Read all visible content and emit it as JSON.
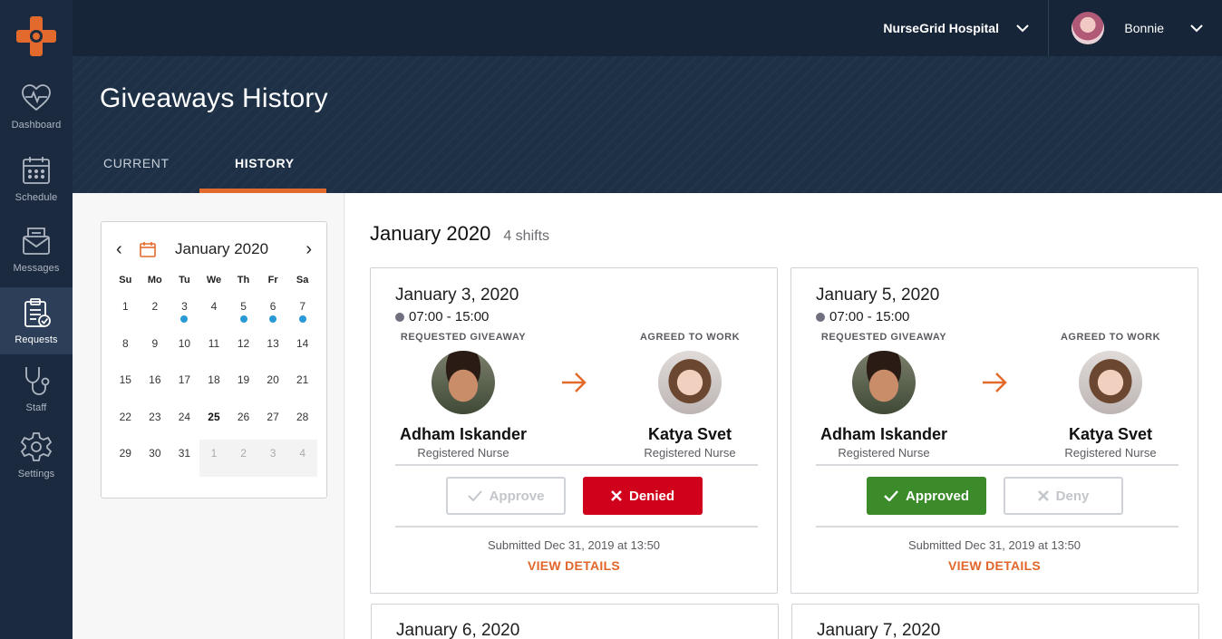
{
  "org": {
    "name": "NurseGrid Hospital"
  },
  "user": {
    "name": "Bonnie"
  },
  "sidebar": {
    "items": [
      {
        "label": "Dashboard",
        "icon": "heart-pulse-icon"
      },
      {
        "label": "Schedule",
        "icon": "calendar-icon"
      },
      {
        "label": "Messages",
        "icon": "envelope-icon"
      },
      {
        "label": "Requests",
        "icon": "clipboard-check-icon",
        "active": true
      },
      {
        "label": "Staff",
        "icon": "stethoscope-icon"
      },
      {
        "label": "Settings",
        "icon": "gear-icon"
      }
    ]
  },
  "header": {
    "title": "Giveaways History",
    "tabs": [
      {
        "label": "CURRENT"
      },
      {
        "label": "HISTORY",
        "active": true
      }
    ]
  },
  "calendar": {
    "title": "January 2020",
    "weekdays": [
      "Su",
      "Mo",
      "Tu",
      "We",
      "Th",
      "Fr",
      "Sa"
    ],
    "weeks": [
      [
        "1",
        "2",
        "3",
        "4",
        "5",
        "6",
        "7"
      ],
      [
        "8",
        "9",
        "10",
        "11",
        "12",
        "13",
        "14"
      ],
      [
        "15",
        "16",
        "17",
        "18",
        "19",
        "20",
        "21"
      ],
      [
        "22",
        "23",
        "24",
        "25",
        "26",
        "27",
        "28"
      ],
      [
        "29",
        "30",
        "31",
        "1",
        "2",
        "3",
        "4"
      ]
    ],
    "today": "25",
    "marked_days": [
      "3",
      "5",
      "6",
      "7"
    ],
    "marker_color": "#2a9ad6"
  },
  "main": {
    "month": "January 2020",
    "shift_count": "4 shifts"
  },
  "cards": [
    {
      "date": "January 3, 2020",
      "time": "07:00 - 15:00",
      "requested_label": "REQUESTED GIVEAWAY",
      "agreed_label": "AGREED TO WORK",
      "from_name": "Adham Iskander",
      "from_role": "Registered Nurse",
      "to_name": "Katya Svet",
      "to_role": "Registered Nurse",
      "btn_left": "Approve",
      "btn_right": "Denied",
      "status": "denied",
      "submitted": "Submitted Dec 31, 2019 at 13:50",
      "details": "VIEW DETAILS"
    },
    {
      "date": "January 5, 2020",
      "time": "07:00 - 15:00",
      "requested_label": "REQUESTED GIVEAWAY",
      "agreed_label": "AGREED TO WORK",
      "from_name": "Adham Iskander",
      "from_role": "Registered Nurse",
      "to_name": "Katya Svet",
      "to_role": "Registered Nurse",
      "btn_left": "Approved",
      "btn_right": "Deny",
      "status": "approved",
      "submitted": "Submitted Dec 31, 2019 at 13:50",
      "details": "VIEW DETAILS"
    },
    {
      "date": "January 6, 2020"
    },
    {
      "date": "January 7, 2020"
    }
  ],
  "colors": {
    "accent": "#e26a2c",
    "denied": "#d0021b",
    "approved": "#3b8b2a",
    "sidebar": "#1b2a3f"
  }
}
